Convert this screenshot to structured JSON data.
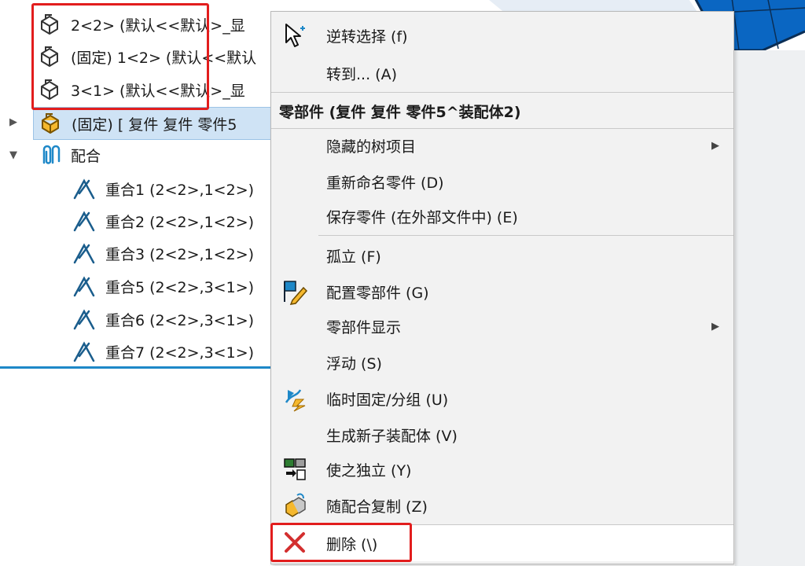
{
  "tree": {
    "rows": [
      {
        "label": "2<2> (默认<<默认>_显"
      },
      {
        "label": "(固定) 1<2> (默认<<默认"
      },
      {
        "label": "3<1> (默认<<默认>_显"
      },
      {
        "label": "(固定) [ 复件 复件 零件5"
      },
      {
        "label": "配合"
      },
      {
        "label": "重合1 (2<2>,1<2>)"
      },
      {
        "label": "重合2 (2<2>,1<2>)"
      },
      {
        "label": "重合3 (2<2>,1<2>)"
      },
      {
        "label": "重合5 (2<2>,3<1>)"
      },
      {
        "label": "重合6 (2<2>,3<1>)"
      },
      {
        "label": "重合7 (2<2>,3<1>)"
      }
    ]
  },
  "menu": {
    "items": [
      {
        "label": "逆转选择 (f)",
        "icon": "cursor-icon"
      },
      {
        "label": "转到... (A)"
      },
      {
        "label": "零部件 (复件 复件 零件5^装配体2)",
        "header": true
      },
      {
        "label": "隐藏的树项目",
        "submenu": true
      },
      {
        "label": "重新命名零件 (D)"
      },
      {
        "label": "保存零件 (在外部文件中) (E)"
      },
      {
        "label": "孤立 (F)"
      },
      {
        "label": "配置零部件 (G)",
        "icon": "configure-component-icon"
      },
      {
        "label": "零部件显示",
        "submenu": true
      },
      {
        "label": "浮动 (S)"
      },
      {
        "label": "临时固定/分组 (U)",
        "icon": "temp-fix-icon"
      },
      {
        "label": "生成新子装配体 (V)"
      },
      {
        "label": "使之独立 (Y)",
        "icon": "make-independent-icon"
      },
      {
        "label": "随配合复制 (Z)",
        "icon": "copy-with-mates-icon"
      },
      {
        "label": "删除 (\\)",
        "icon": "delete-icon"
      }
    ]
  },
  "colors": {
    "highlight_box": "#e21d1d",
    "selection_bg": "#cfe3f5",
    "tree_bottom_line": "#1e88c8",
    "model_blue": "#0a66c2"
  }
}
